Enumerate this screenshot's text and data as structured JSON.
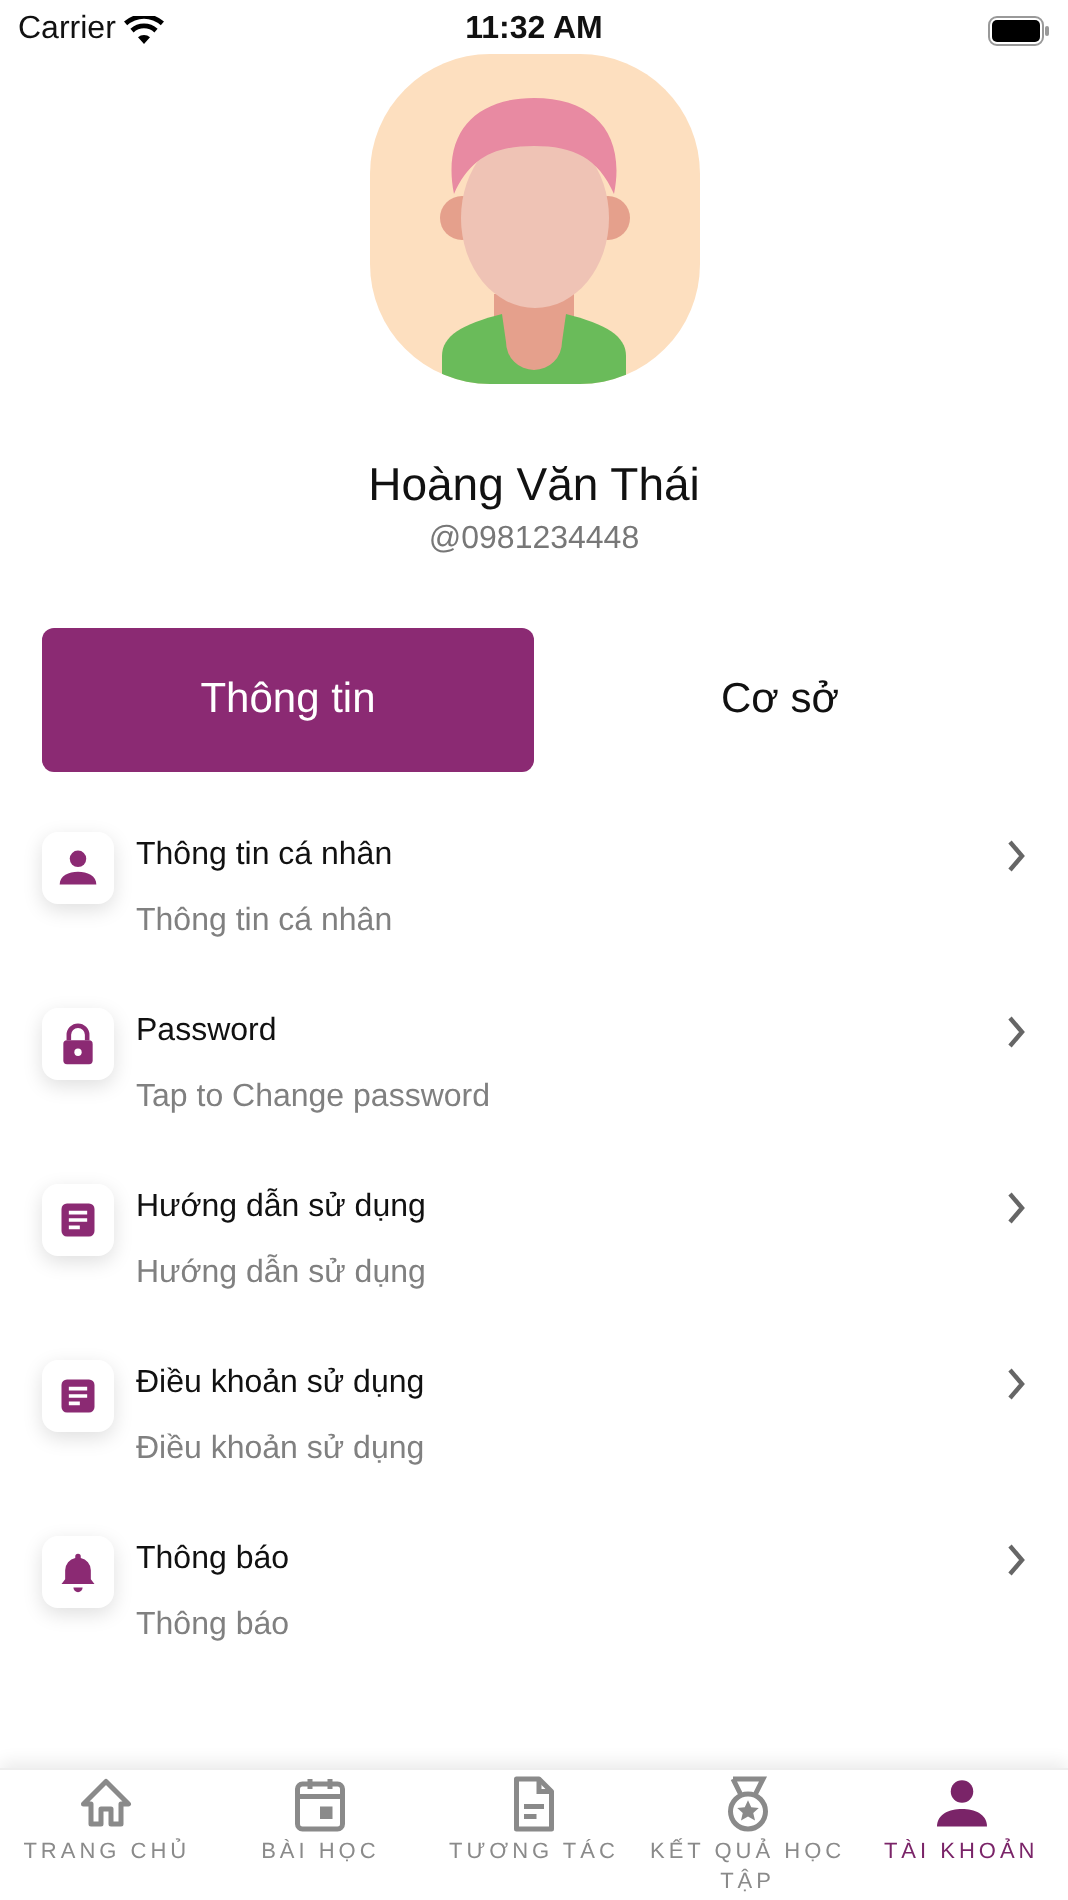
{
  "status_bar": {
    "carrier": "Carrier",
    "time": "11:32 AM"
  },
  "profile": {
    "name": "Hoàng Văn Thái",
    "handle": "@0981234448"
  },
  "segments": [
    {
      "label": "Thông tin",
      "selected": true
    },
    {
      "label": "Cơ sở",
      "selected": false
    }
  ],
  "menu_items": [
    {
      "kind": "person",
      "title": "Thông tin cá nhân",
      "subtitle": "Thông tin cá nhân"
    },
    {
      "kind": "lock",
      "title": "Password",
      "subtitle": "Tap to Change password"
    },
    {
      "kind": "document",
      "title": "Hướng dẫn sử dụng",
      "subtitle": "Hướng dẫn sử dụng"
    },
    {
      "kind": "document",
      "title": "Điều khoản sử dụng",
      "subtitle": "Điều khoản sử dụng"
    },
    {
      "kind": "bell",
      "title": "Thông báo",
      "subtitle": "Thông báo"
    }
  ],
  "tab_bar": [
    {
      "kind": "home",
      "label": "TRANG CHỦ",
      "selected": false
    },
    {
      "kind": "calendar",
      "label": "BÀI HỌC",
      "selected": false
    },
    {
      "kind": "file",
      "label": "TƯƠNG TÁC",
      "selected": false
    },
    {
      "kind": "medal",
      "label": "KẾT QUẢ HỌC TẬP",
      "selected": false
    },
    {
      "kind": "person",
      "label": "TÀI KHOẢN",
      "selected": true
    }
  ]
}
